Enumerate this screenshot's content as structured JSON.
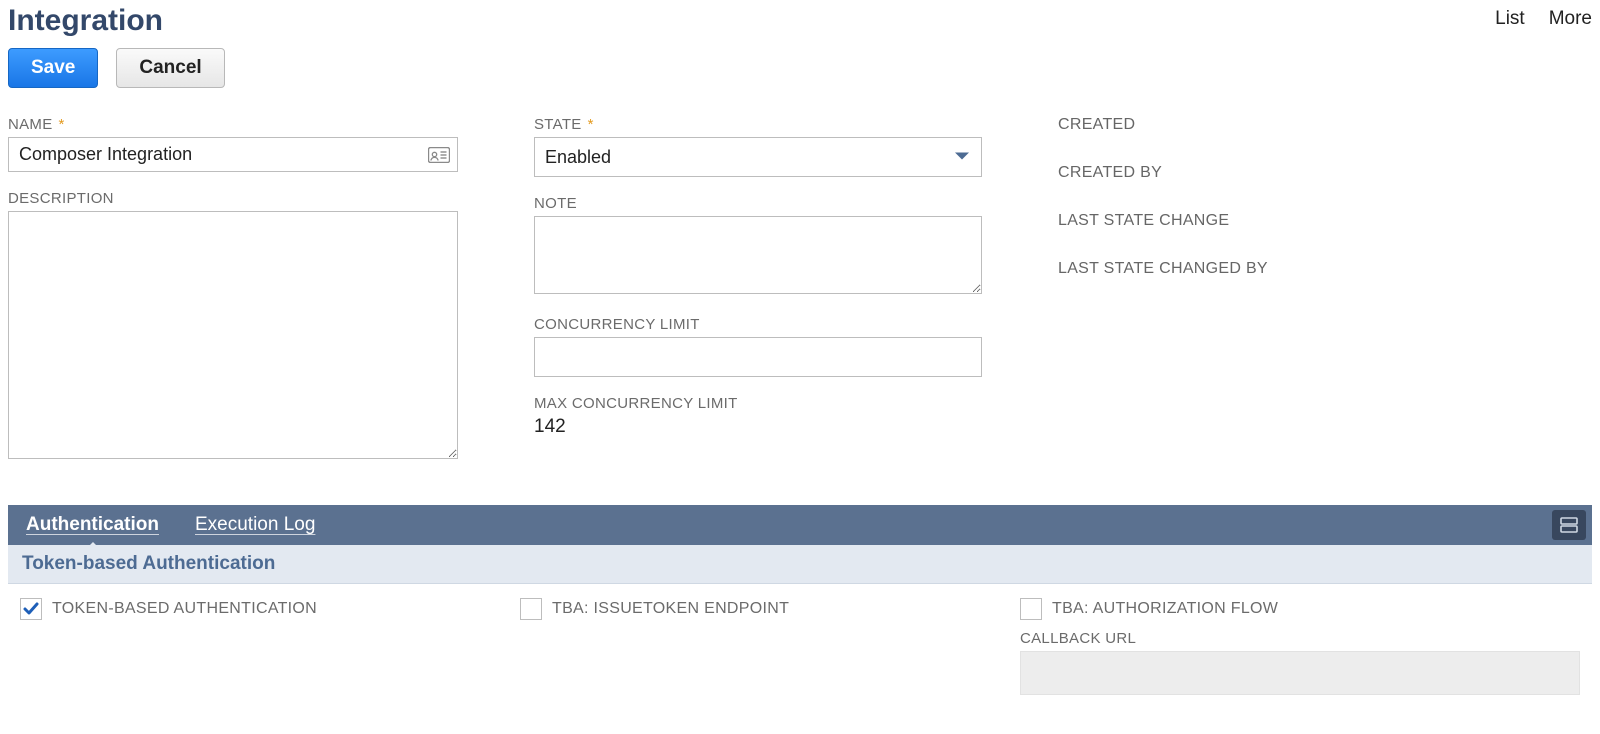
{
  "header": {
    "title": "Integration",
    "links": {
      "list": "List",
      "more": "More"
    }
  },
  "buttons": {
    "save": "Save",
    "cancel": "Cancel"
  },
  "form": {
    "name": {
      "label": "NAME",
      "value": "Composer Integration"
    },
    "description": {
      "label": "DESCRIPTION",
      "value": ""
    },
    "state": {
      "label": "STATE",
      "value": "Enabled"
    },
    "note": {
      "label": "NOTE",
      "value": ""
    },
    "concurrency": {
      "label": "CONCURRENCY LIMIT",
      "value": ""
    },
    "maxConcurrency": {
      "label": "MAX CONCURRENCY LIMIT",
      "value": "142"
    }
  },
  "meta": {
    "created": "CREATED",
    "createdBy": "CREATED BY",
    "lastStateChange": "LAST STATE CHANGE",
    "lastStateChangedBy": "LAST STATE CHANGED BY"
  },
  "tabs": {
    "authentication": "Authentication",
    "executionLog": "Execution Log"
  },
  "auth": {
    "sectionTitle": "Token-based Authentication",
    "tba": {
      "label": "TOKEN-BASED AUTHENTICATION",
      "checked": true
    },
    "issueToken": {
      "label": "TBA: ISSUETOKEN ENDPOINT",
      "checked": false
    },
    "authFlow": {
      "label": "TBA: AUTHORIZATION FLOW",
      "checked": false
    },
    "callback": {
      "label": "CALLBACK URL",
      "value": ""
    }
  }
}
